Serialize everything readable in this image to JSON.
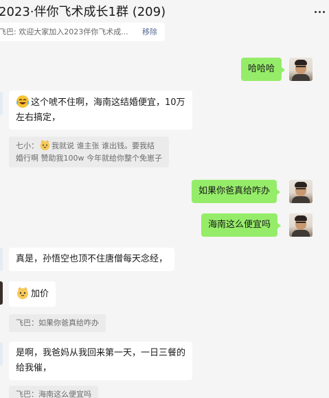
{
  "header": {
    "title": "2023·伴你飞术成长1群 (209)",
    "more_icon": "more-horizontal-icon"
  },
  "notice": {
    "text": "飞巴: 欢迎大家加入2023伴你飞术成...",
    "remove_label": "移除"
  },
  "messages": {
    "m1": {
      "text": "哈哈哈"
    },
    "m2": {
      "line1": "这个唬不住啊，海南这结婚便宜，10万",
      "line2": "左右搞定，",
      "emoji": "crying-laughing-emoji"
    },
    "q1": {
      "sender": "七小：",
      "line1_rest": "我就说 谁主张 谁出钱。要我结",
      "line2": "婚行啊 赞助我100w 今年就给你整个免崽子",
      "emoji": "cat-face-emoji"
    },
    "m3": {
      "text": "如果你爸真给咋办"
    },
    "m4": {
      "text": "海南这么便宜吗"
    },
    "m5": {
      "text": "真是，孙悟空也顶不住唐僧每天念经，"
    },
    "m6": {
      "text": "加价",
      "emoji": "cat-face-emoji"
    },
    "q2": {
      "text": "飞巴：如果你爸真给咋办"
    },
    "m7": {
      "line1": "是啊，我爸妈从我回来第一天，一日三餐的",
      "line2": "给我催，"
    },
    "q3": {
      "text": "飞巴：海南这么便宜吗"
    }
  },
  "colors": {
    "background": "#f5f5f5",
    "my_bubble": "#95ec69",
    "other_bubble": "#ffffff",
    "quote_bg": "#ebebeb",
    "link": "#576b95"
  }
}
